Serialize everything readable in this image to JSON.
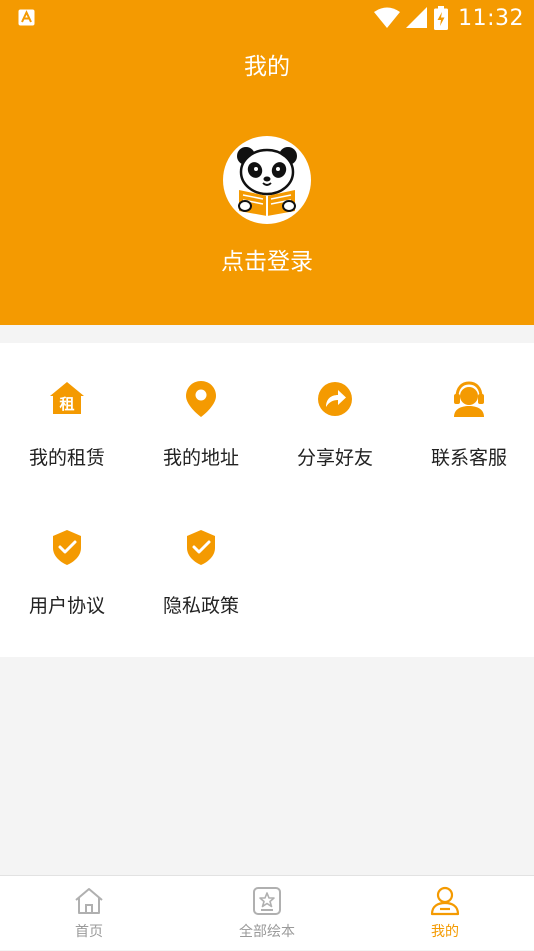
{
  "status_bar": {
    "time": "11:32",
    "app_icon": "a-letter-icon",
    "icons": [
      "wifi-icon",
      "cell-signal-icon",
      "battery-charging-icon"
    ]
  },
  "header": {
    "title": "我的",
    "login_label": "点击登录",
    "avatar_icon": "panda-reading-icon"
  },
  "menu": {
    "items": [
      {
        "label": "我的租赁",
        "icon": "rent-house-icon",
        "icon_text": "租"
      },
      {
        "label": "我的地址",
        "icon": "location-pin-icon"
      },
      {
        "label": "分享好友",
        "icon": "share-icon"
      },
      {
        "label": "联系客服",
        "icon": "customer-service-icon"
      },
      {
        "label": "用户协议",
        "icon": "shield-check-icon"
      },
      {
        "label": "隐私政策",
        "icon": "shield-check-icon"
      }
    ]
  },
  "tabbar": {
    "tabs": [
      {
        "label": "首页",
        "icon": "home-icon",
        "active": false
      },
      {
        "label": "全部绘本",
        "icon": "star-book-icon",
        "active": false
      },
      {
        "label": "我的",
        "icon": "user-icon",
        "active": true
      }
    ]
  },
  "colors": {
    "accent": "#f49a01",
    "background": "#f4f4f4",
    "inactive_tab": "#9a9a9a"
  }
}
